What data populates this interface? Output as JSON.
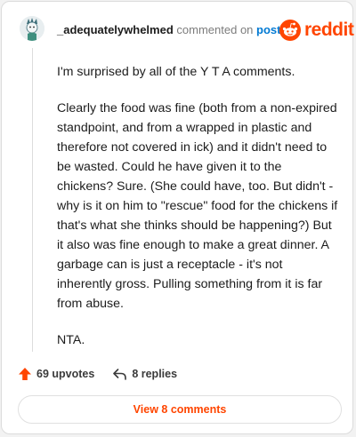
{
  "header": {
    "username": "_adequatelywhelmed",
    "action_text": "commented on",
    "post_link": "post",
    "brand": "reddit",
    "brand_color": "#ff4500"
  },
  "comment": {
    "paragraphs": [
      "I'm surprised by all of the Y T A comments.",
      "Clearly the food was fine (both from a non-expired standpoint, and from a wrapped in plastic and therefore not covered in ick) and it didn't need to be wasted. Could he have given it to the chickens? Sure. (She could have, too. But didn't - why is it on him to \"rescue\" food for the chickens if that's what she thinks should be happening?) But it also was fine enough to make a great dinner. A garbage can is just a receptacle - it's not inherently gross. Pulling something from it is far from abuse.",
      "NTA."
    ]
  },
  "actions": {
    "upvotes": "69 upvotes",
    "replies": "8 replies",
    "upvote_icon": "upvote-arrow-icon",
    "reply_icon": "reply-arrow-icon"
  },
  "view_comments_label": "View 8 comments"
}
